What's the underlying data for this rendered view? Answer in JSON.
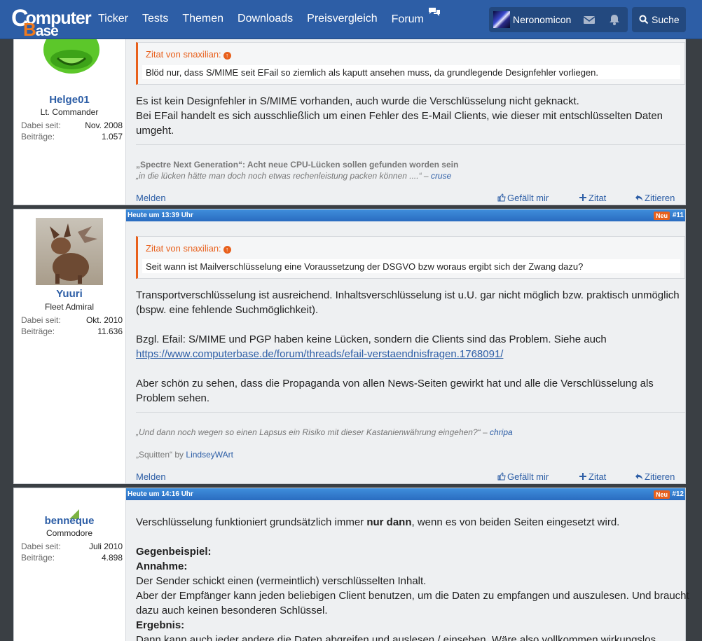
{
  "header": {
    "logo_top": "Computer",
    "logo_bottom": "Base",
    "nav": [
      "Ticker",
      "Tests",
      "Themen",
      "Downloads",
      "Preisvergleich",
      "Forum"
    ],
    "username": "Neronomicon",
    "search_label": "Suche"
  },
  "posts": [
    {
      "user": {
        "name": "Helge01",
        "rank": "Lt. Commander",
        "since_label": "Dabei seit:",
        "since": "Nov. 2008",
        "posts_label": "Beiträge:",
        "posts": "1.057"
      },
      "quote": {
        "header": "Zitat von snaxilian:",
        "text": "Blöd nur, dass S/MIME seit EFail so ziemlich als kaputt ansehen muss, da grundlegende Designfehler vorliegen."
      },
      "body": [
        "Es ist kein Designfehler in S/MIME vorhanden, auch wurde die Verschlüsselung nicht geknackt.",
        "Bei EFail handelt es sich ausschließlich um einen Fehler des E-Mail Clients, wie dieser mit entschlüsselten Daten umgeht."
      ],
      "signature": {
        "title": "„Spectre Next Generation“: Acht neue CPU-Lücken sollen gefunden worden sein",
        "quote": "„in die lücken hätte man doch noch etwas rechenleistung packen können ....“",
        "author_sep": " – ",
        "author": "cruse"
      },
      "actions": {
        "report": "Melden",
        "like": "Gefällt mir",
        "quote": "Zitat",
        "reply": "Zitieren"
      }
    },
    {
      "date": "Heute um 13:39 Uhr",
      "badge": "Neu",
      "number": "#11",
      "user": {
        "name": "Yuuri",
        "rank": "Fleet Admiral",
        "since_label": "Dabei seit:",
        "since": "Okt. 2010",
        "posts_label": "Beiträge:",
        "posts": "11.636"
      },
      "quote": {
        "header": "Zitat von snaxilian:",
        "text": "Seit wann ist Mailverschlüsselung eine Voraussetzung der DSGVO bzw woraus ergibt sich der Zwang dazu?"
      },
      "body1": "Transportverschlüsselung ist ausreichend. Inhaltsverschlüsselung ist u.U. gar nicht möglich bzw. praktisch unmöglich (bspw. eine fehlende Suchmöglichkeit).",
      "body2": "Bzgl. Efail: S/MIME und PGP haben keine Lücken, sondern die Clients sind das Problem. Siehe auch",
      "link": "https://www.computerbase.de/forum/threads/efail-verstaendnisfragen.1768091/",
      "body3": "Aber schön zu sehen, dass die Propaganda von allen News-Seiten gewirkt hat und alle die Verschlüsselung als Problem sehen.",
      "signature": {
        "quote": "„Und dann noch wegen so einen Lapsus ein Risiko mit dieser Kastanienwährung eingehen?“",
        "author_sep": " – ",
        "author": "chripa",
        "art": "„Squitten“ by",
        "artist": "LindseyWArt"
      },
      "actions": {
        "report": "Melden",
        "like": "Gefällt mir",
        "quote": "Zitat",
        "reply": "Zitieren"
      }
    },
    {
      "date": "Heute um 14:16 Uhr",
      "badge": "Neu",
      "number": "#12",
      "user": {
        "name": "benneque",
        "rank": "Commodore",
        "since_label": "Dabei seit:",
        "since": "Juli 2010",
        "posts_label": "Beiträge:",
        "posts": "4.898"
      },
      "line1_pre": "Verschlüsselung funktioniert grundsätzlich immer ",
      "line1_bold": "nur dann",
      "line1_post": ", wenn es von beiden Seiten eingesetzt wird.",
      "h1": "Gegenbeispiel:",
      "h2": "Annahme:",
      "l2": "Der Sender schickt einen (vermeintlich) verschlüsselten Inhalt.",
      "l3": "Aber der Empfänger kann jeden beliebigen Client benutzen, um die Daten zu empfangen und auszulesen. Und braucht dazu auch keinen besonderen Schlüssel.",
      "h3": "Ergebnis:",
      "l4": "Dann kann auch jeder andere die Daten abgreifen und auslesen / einsehen. Wäre also vollkommen wirkungslos."
    }
  ],
  "colors": {
    "brand": "#2d5ea6",
    "accent": "#e8601c",
    "post_header": "#3f8edc"
  }
}
